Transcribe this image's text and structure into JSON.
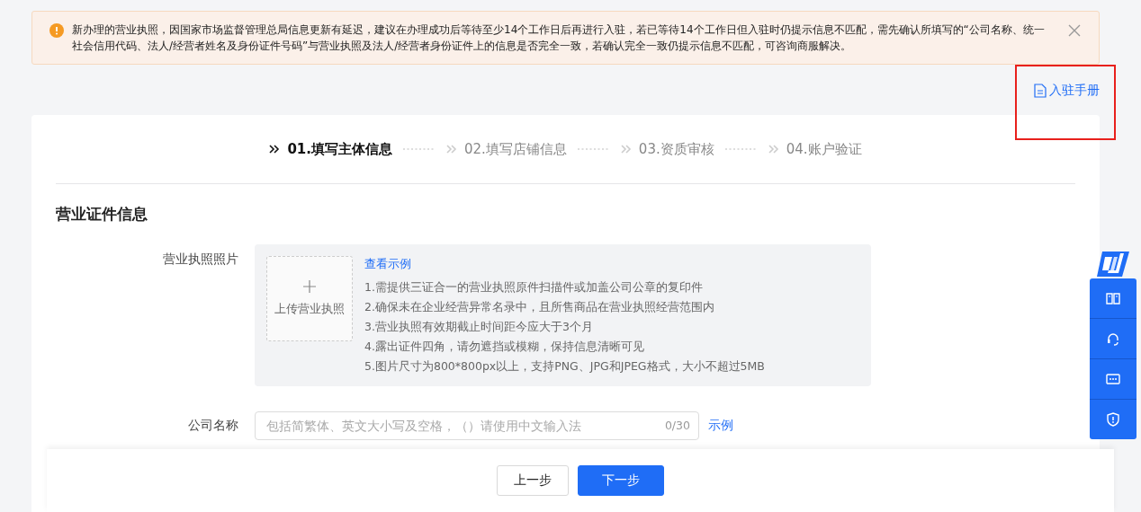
{
  "notice": {
    "text": "新办理的营业执照，因国家市场监督管理总局信息更新有延迟，建议在办理成功后等待至少14个工作日后再进行入驻，若已等待14个工作日但入驻时仍提示信息不匹配，需先确认所填写的“公司名称、统一社会信用代码、法人/经营者姓名及身份证件号码”与营业执照及法人/经营者身份证件上的信息是否完全一致，若确认完全一致仍提示信息不匹配，可咨询商服解决。"
  },
  "manual_link": "入驻手册",
  "steps": [
    {
      "label": "01.填写主体信息",
      "selected": true
    },
    {
      "label": "02.填写店铺信息",
      "selected": false
    },
    {
      "label": "03.资质审核",
      "selected": false
    },
    {
      "label": "04.账户验证",
      "selected": false
    }
  ],
  "section_title": "营业证件信息",
  "license_photo": {
    "label": "营业执照照片",
    "upload_label": "上传营业执照",
    "example_link": "查看示例",
    "requirements": [
      "1.需提供三证合一的营业执照原件扫描件或加盖公司公章的复印件",
      "2.确保未在企业经营异常名录中，且所售商品在营业执照经营范围内",
      "3.营业执照有效期截止时间距今应大于3个月",
      "4.露出证件四角，请勿遮挡或模糊，保持信息清晰可见",
      "5.图片尺寸为800*800px以上，支持PNG、JPG和JPEG格式，大小不超过5MB"
    ]
  },
  "company_name": {
    "label": "公司名称",
    "placeholder": "包括简繁体、英文大小写及空格，（）请使用中文输入法",
    "counter": "0/30",
    "example_link": "示例"
  },
  "buttons": [
    {
      "label": "上一步",
      "kind": "secondary"
    },
    {
      "label": "下一步",
      "kind": "primary"
    }
  ]
}
